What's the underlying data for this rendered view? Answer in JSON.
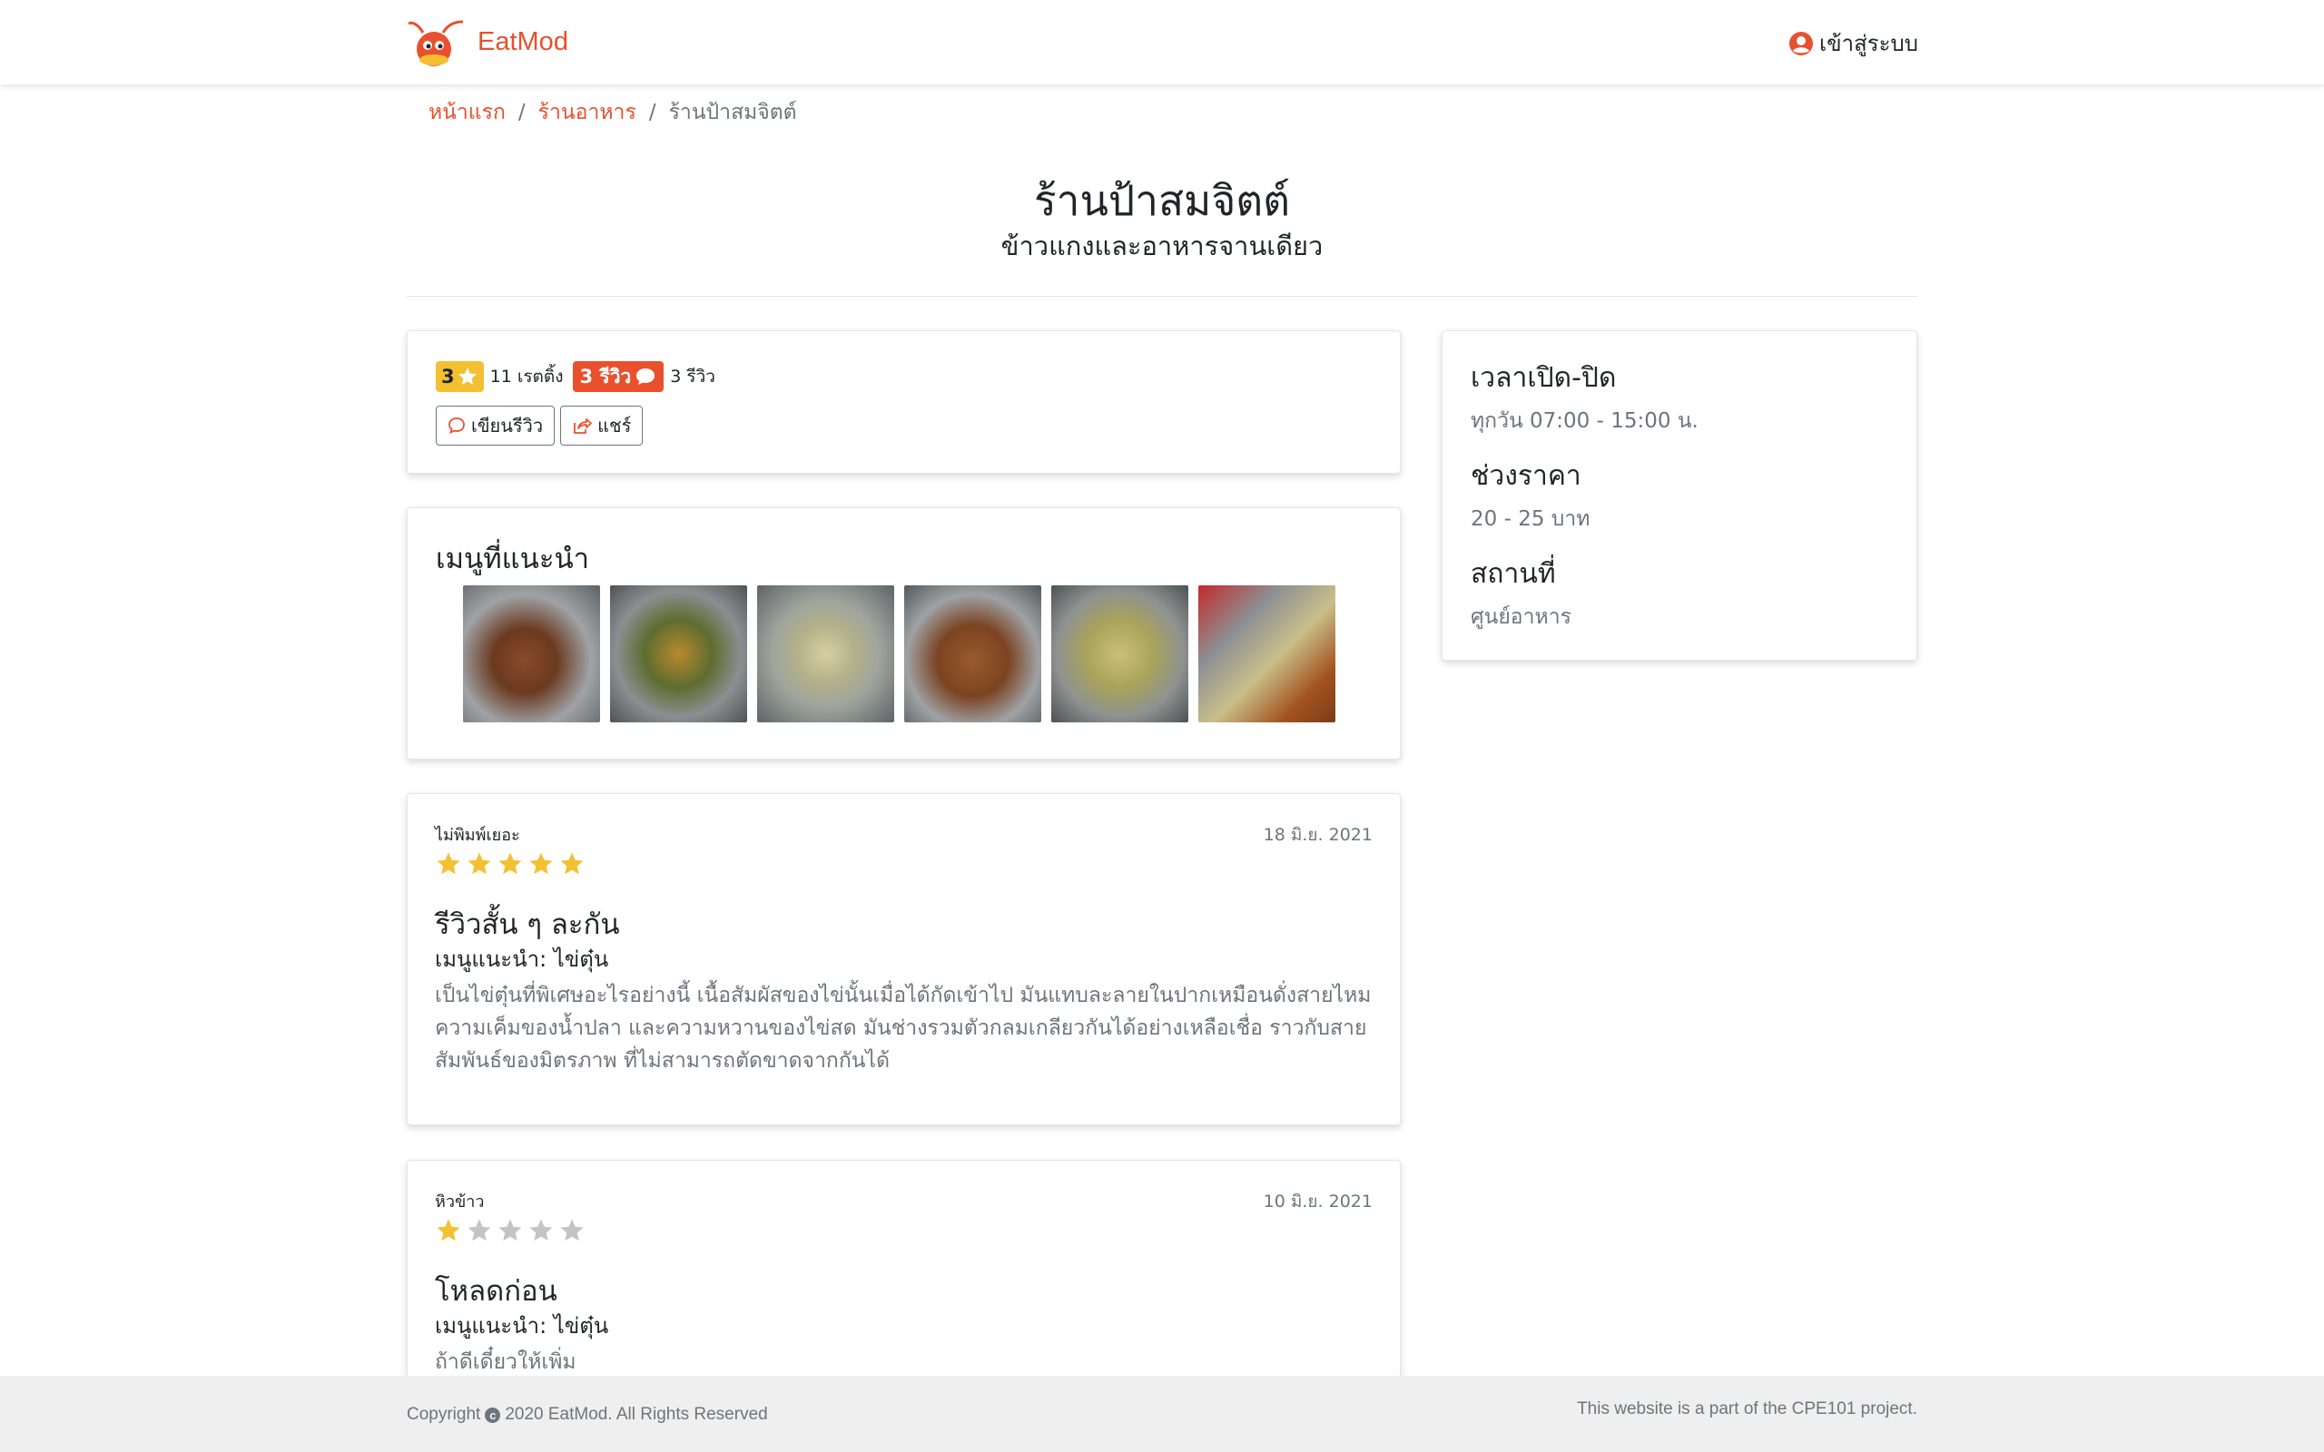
{
  "nav": {
    "brand": "EatMod",
    "login_label": "เข้าสู่ระบบ"
  },
  "breadcrumb": {
    "home": "หน้าแรก",
    "restaurants": "ร้านอาหาร",
    "current": "ร้านป้าสมจิตต์"
  },
  "shop": {
    "name": "ร้านป้าสมจิตต์",
    "category": "ข้าวแกงและอาหารจานเดียว"
  },
  "rating": {
    "score": "3",
    "rating_count": "11 เรตติ้ง",
    "review_badge": "3 รีวิว",
    "review_count": "3 รีวิว",
    "write_review": "เขียนรีวิว",
    "share": "แชร์"
  },
  "menu": {
    "title": "เมนูที่แนะนำ",
    "images": [
      "fried-chicken-tray",
      "stir-fried-vegetables-tray",
      "fish-curry-tray",
      "fried-chicken-tray-2",
      "green-curry-tray",
      "curry-and-fried-food-tray"
    ]
  },
  "info": {
    "hours_label": "เวลาเปิด-ปิด",
    "hours_value": "ทุกวัน 07:00 - 15:00 น.",
    "price_label": "ช่วงราคา",
    "price_value": "20 - 25 บาท",
    "location_label": "สถานที่",
    "location_value": "ศูนย์อาหาร"
  },
  "reviews": [
    {
      "user": "ไม่พิมพ์เยอะ",
      "date": "18 มิ.ย. 2021",
      "stars": 5,
      "title": "รีวิวสั้น ๆ ละกัน",
      "menu": "เมนูแนะนำ: ไข่ตุ๋น",
      "body": "เป็นไข่ตุ๋นที่พิเศษอะไรอย่างนี้ เนื้อสัมผัสของไข่นั้นเมื่อได้กัดเข้าไป มันแทบละลายในปากเหมือนดั่งสายไหม ความเค็มของน้ำปลา และความหวานของไข่สด มันช่างรวมตัวกลมเกลียวกันได้อย่างเหลือเชื่อ ราวกับสายสัมพันธ์ของมิตรภาพ ที่ไม่สามารถตัดขาดจากกันได้"
    },
    {
      "user": "หิวข้าว",
      "date": "10 มิ.ย. 2021",
      "stars": 1,
      "title": "โหลดก่อน",
      "menu": "เมนูแนะนำ: ไข่ตุ๋น",
      "body": "ถ้าดีเดี๋ยวให้เพิ่ม"
    }
  ],
  "footer": {
    "copy_prefix": "Copyright",
    "copy_suffix": "2020 EatMod. All Rights Reserved",
    "note": "This website is a part of the CPE101 project."
  },
  "colors": {
    "brand": "#e8502e",
    "star": "#f4c031",
    "star_empty": "#c4c4c4"
  }
}
